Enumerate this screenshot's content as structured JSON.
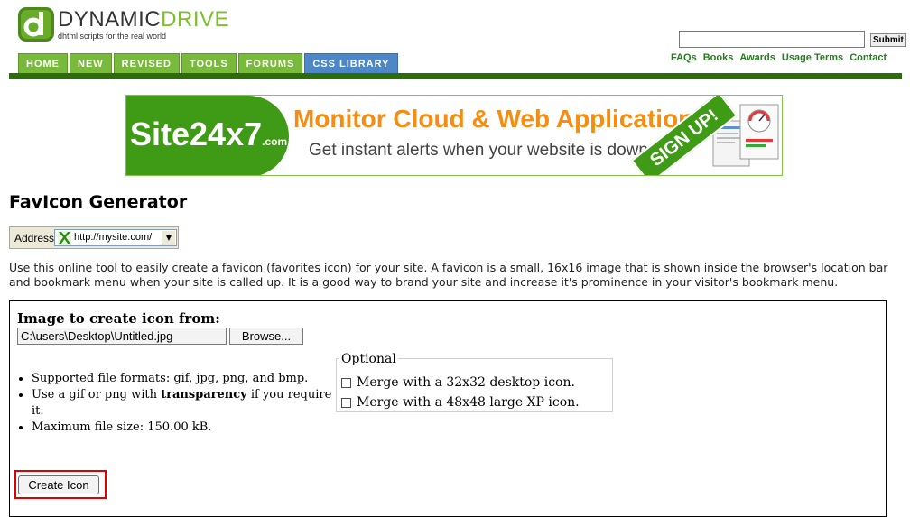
{
  "header": {
    "logo_word1": "DYNAMIC",
    "logo_word2": "DRIVE",
    "tagline": "dhtml scripts for the real world",
    "nav_tabs": [
      "HOME",
      "NEW",
      "REVISED",
      "TOOLS",
      "FORUMS",
      "CSS LIBRARY"
    ],
    "search_submit": "Submit",
    "top_links": [
      "FAQs",
      "Books",
      "Awards",
      "Usage Terms",
      "Contact"
    ]
  },
  "banner": {
    "brand": "Site24x7",
    "brand_suffix": ".com",
    "headline": "Monitor Cloud & Web Applications",
    "subline": "Get instant alerts when your website is down",
    "cta": "SIGN UP!"
  },
  "page": {
    "title": "FavIcon Generator",
    "address_label": "Address",
    "address_value": "http://mysite.com/",
    "intro": "Use this online tool to easily create a favicon (favorites icon) for your site. A favicon is a small, 16x16 image that is shown inside the browser's location bar and bookmark menu when your site is called up. It is a good way to brand your site and increase it's prominence in your visitor's bookmark menu."
  },
  "form": {
    "heading": "Image to create icon from:",
    "file_value": "C:\\users\\Desktop\\Untitled.jpg",
    "browse_label": "Browse...",
    "info": {
      "formats": "Supported file formats: gif, jpg, png, and bmp.",
      "transparency_before": "Use a gif or png with ",
      "transparency_bold": "transparency",
      "transparency_after": " if you require it.",
      "max_size": "Maximum file size: 150.00 kB."
    },
    "optional_legend": "Optional",
    "option1": "Merge with a 32x32 desktop icon.",
    "option2": "Merge with a 48x48 large XP icon.",
    "create_label": "Create Icon"
  },
  "colors": {
    "nav_green": "#79b93c",
    "nav_blue": "#4d87c7",
    "divider_green": "#2e6b0c",
    "link_green": "#2a7a23",
    "highlight_red": "#e00000"
  }
}
